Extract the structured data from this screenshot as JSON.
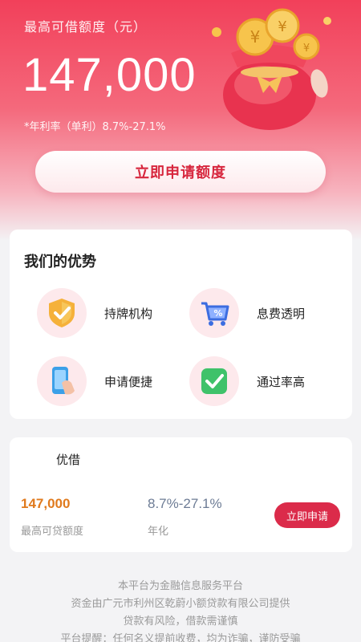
{
  "hero": {
    "title": "最高可借额度（元）",
    "amount": "147,000",
    "rate": "*年利率（单利）8.7%-27.1%",
    "apply_label": "立即申请额度"
  },
  "advantages": {
    "title": "我们的优势",
    "items": [
      {
        "label": "持牌机构",
        "icon": "shield-icon"
      },
      {
        "label": "息费透明",
        "icon": "percent-cart-icon"
      },
      {
        "label": "申请便捷",
        "icon": "phone-hand-icon"
      },
      {
        "label": "通过率高",
        "icon": "check-icon"
      }
    ]
  },
  "loan": {
    "name": "优借",
    "amount": "147,000",
    "amount_label": "最高可贷额度",
    "rate": "8.7%-27.1%",
    "rate_label": "年化",
    "apply_label": "立即申请"
  },
  "footer": {
    "lines": [
      "本平台为金融信息服务平台",
      "资金由广元市利州区乾蔚小额贷款有限公司提供",
      "贷款有风险，借款需谨慎",
      "平台提醒：任何名义提前收费，均为诈骗，谨防受骗"
    ]
  },
  "colors": {
    "accent": "#db2b4a",
    "amount_orange": "#e07a1d",
    "hero_top": "#f2405a"
  }
}
